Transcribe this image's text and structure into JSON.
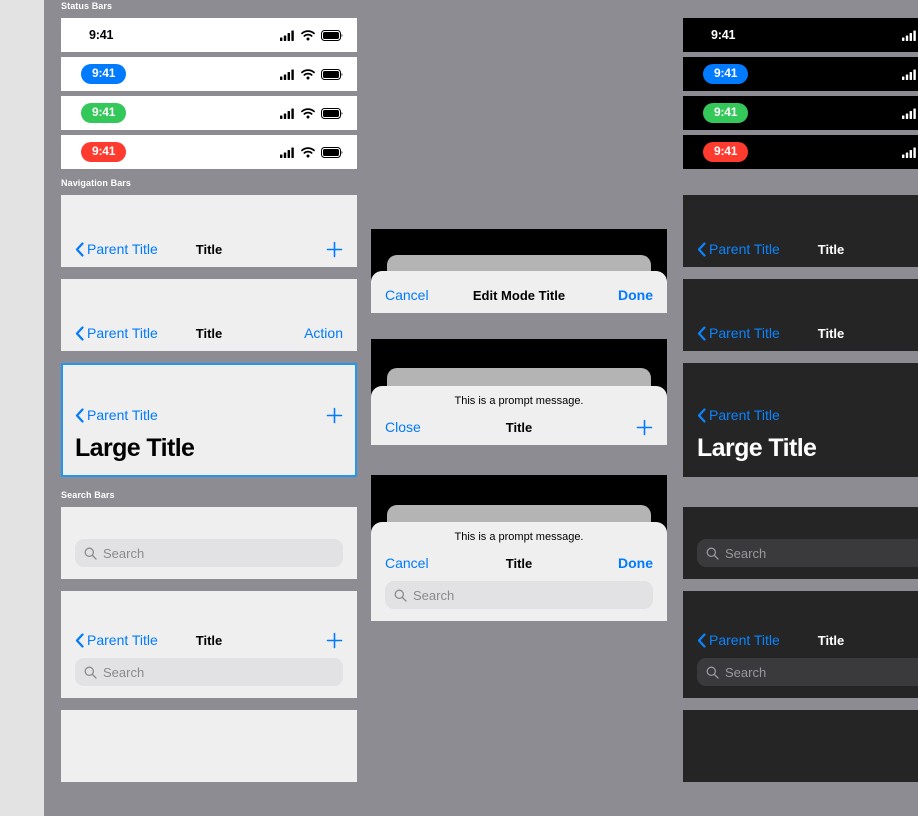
{
  "accent": {
    "ios_blue": "#007AFF",
    "ios_blue_dark": "#0A84FF",
    "green": "#34C759",
    "red": "#FF3B30",
    "canvas_bg": "#8C8C92",
    "card_bg_light": "#EFEFEF",
    "card_bg_dark": "#252525",
    "selection": "#2196F3"
  },
  "sections": {
    "status_bars": {
      "label": "Status Bars"
    },
    "navigation_bars": {
      "label": "Navigation Bars"
    },
    "search_bars": {
      "label": "Search Bars"
    }
  },
  "status_bars": {
    "time": "9:41",
    "variants": [
      {
        "style": "plain",
        "time": "9:41"
      },
      {
        "style": "pill-blue",
        "time": "9:41"
      },
      {
        "style": "pill-green",
        "time": "9:41"
      },
      {
        "style": "pill-red",
        "time": "9:41"
      }
    ],
    "icons": [
      "cellular-icon",
      "wifi-icon",
      "battery-icon"
    ]
  },
  "navigation_bars": {
    "back_label": "Parent Title",
    "title": "Title",
    "large_title": "Large Title",
    "action_label": "Action",
    "add_icon": "plus-icon",
    "back_icon": "chevron-left-icon"
  },
  "modals": {
    "edit_mode": {
      "cancel": "Cancel",
      "title": "Edit Mode Title",
      "done": "Done"
    },
    "prompt_nav": {
      "prompt": "This is a prompt message.",
      "close": "Close",
      "title": "Title",
      "add_icon": "plus-icon"
    },
    "prompt_search": {
      "prompt": "This is a prompt message.",
      "cancel": "Cancel",
      "title": "Title",
      "done": "Done",
      "search_placeholder": "Search",
      "search_icon": "magnifier-icon"
    }
  },
  "search_bars": {
    "placeholder": "Search",
    "search_icon": "magnifier-icon",
    "back_label": "Parent Title",
    "title": "Title",
    "add_icon": "plus-icon"
  }
}
